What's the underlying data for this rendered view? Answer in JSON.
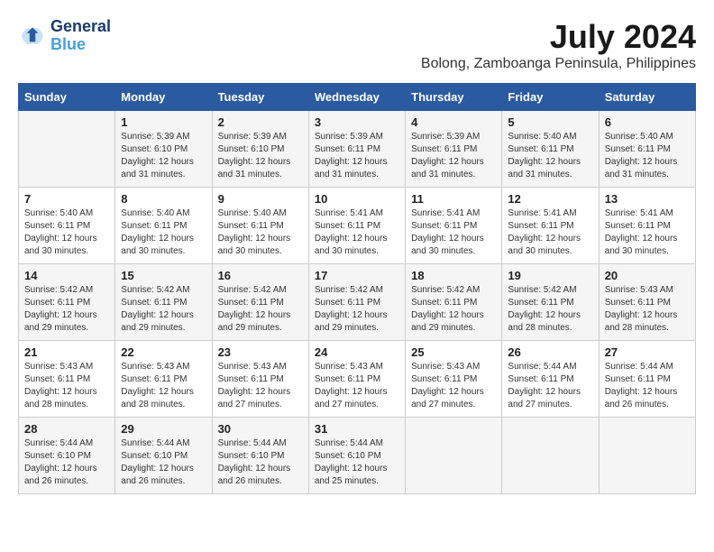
{
  "logo": {
    "line1": "General",
    "line2": "Blue"
  },
  "title": "July 2024",
  "location": "Bolong, Zamboanga Peninsula, Philippines",
  "weekdays": [
    "Sunday",
    "Monday",
    "Tuesday",
    "Wednesday",
    "Thursday",
    "Friday",
    "Saturday"
  ],
  "weeks": [
    [
      {
        "day": "",
        "sunrise": "",
        "sunset": "",
        "daylight": ""
      },
      {
        "day": "1",
        "sunrise": "Sunrise: 5:39 AM",
        "sunset": "Sunset: 6:10 PM",
        "daylight": "Daylight: 12 hours and 31 minutes."
      },
      {
        "day": "2",
        "sunrise": "Sunrise: 5:39 AM",
        "sunset": "Sunset: 6:10 PM",
        "daylight": "Daylight: 12 hours and 31 minutes."
      },
      {
        "day": "3",
        "sunrise": "Sunrise: 5:39 AM",
        "sunset": "Sunset: 6:11 PM",
        "daylight": "Daylight: 12 hours and 31 minutes."
      },
      {
        "day": "4",
        "sunrise": "Sunrise: 5:39 AM",
        "sunset": "Sunset: 6:11 PM",
        "daylight": "Daylight: 12 hours and 31 minutes."
      },
      {
        "day": "5",
        "sunrise": "Sunrise: 5:40 AM",
        "sunset": "Sunset: 6:11 PM",
        "daylight": "Daylight: 12 hours and 31 minutes."
      },
      {
        "day": "6",
        "sunrise": "Sunrise: 5:40 AM",
        "sunset": "Sunset: 6:11 PM",
        "daylight": "Daylight: 12 hours and 31 minutes."
      }
    ],
    [
      {
        "day": "7",
        "sunrise": "Sunrise: 5:40 AM",
        "sunset": "Sunset: 6:11 PM",
        "daylight": "Daylight: 12 hours and 30 minutes."
      },
      {
        "day": "8",
        "sunrise": "Sunrise: 5:40 AM",
        "sunset": "Sunset: 6:11 PM",
        "daylight": "Daylight: 12 hours and 30 minutes."
      },
      {
        "day": "9",
        "sunrise": "Sunrise: 5:40 AM",
        "sunset": "Sunset: 6:11 PM",
        "daylight": "Daylight: 12 hours and 30 minutes."
      },
      {
        "day": "10",
        "sunrise": "Sunrise: 5:41 AM",
        "sunset": "Sunset: 6:11 PM",
        "daylight": "Daylight: 12 hours and 30 minutes."
      },
      {
        "day": "11",
        "sunrise": "Sunrise: 5:41 AM",
        "sunset": "Sunset: 6:11 PM",
        "daylight": "Daylight: 12 hours and 30 minutes."
      },
      {
        "day": "12",
        "sunrise": "Sunrise: 5:41 AM",
        "sunset": "Sunset: 6:11 PM",
        "daylight": "Daylight: 12 hours and 30 minutes."
      },
      {
        "day": "13",
        "sunrise": "Sunrise: 5:41 AM",
        "sunset": "Sunset: 6:11 PM",
        "daylight": "Daylight: 12 hours and 30 minutes."
      }
    ],
    [
      {
        "day": "14",
        "sunrise": "Sunrise: 5:42 AM",
        "sunset": "Sunset: 6:11 PM",
        "daylight": "Daylight: 12 hours and 29 minutes."
      },
      {
        "day": "15",
        "sunrise": "Sunrise: 5:42 AM",
        "sunset": "Sunset: 6:11 PM",
        "daylight": "Daylight: 12 hours and 29 minutes."
      },
      {
        "day": "16",
        "sunrise": "Sunrise: 5:42 AM",
        "sunset": "Sunset: 6:11 PM",
        "daylight": "Daylight: 12 hours and 29 minutes."
      },
      {
        "day": "17",
        "sunrise": "Sunrise: 5:42 AM",
        "sunset": "Sunset: 6:11 PM",
        "daylight": "Daylight: 12 hours and 29 minutes."
      },
      {
        "day": "18",
        "sunrise": "Sunrise: 5:42 AM",
        "sunset": "Sunset: 6:11 PM",
        "daylight": "Daylight: 12 hours and 29 minutes."
      },
      {
        "day": "19",
        "sunrise": "Sunrise: 5:42 AM",
        "sunset": "Sunset: 6:11 PM",
        "daylight": "Daylight: 12 hours and 28 minutes."
      },
      {
        "day": "20",
        "sunrise": "Sunrise: 5:43 AM",
        "sunset": "Sunset: 6:11 PM",
        "daylight": "Daylight: 12 hours and 28 minutes."
      }
    ],
    [
      {
        "day": "21",
        "sunrise": "Sunrise: 5:43 AM",
        "sunset": "Sunset: 6:11 PM",
        "daylight": "Daylight: 12 hours and 28 minutes."
      },
      {
        "day": "22",
        "sunrise": "Sunrise: 5:43 AM",
        "sunset": "Sunset: 6:11 PM",
        "daylight": "Daylight: 12 hours and 28 minutes."
      },
      {
        "day": "23",
        "sunrise": "Sunrise: 5:43 AM",
        "sunset": "Sunset: 6:11 PM",
        "daylight": "Daylight: 12 hours and 27 minutes."
      },
      {
        "day": "24",
        "sunrise": "Sunrise: 5:43 AM",
        "sunset": "Sunset: 6:11 PM",
        "daylight": "Daylight: 12 hours and 27 minutes."
      },
      {
        "day": "25",
        "sunrise": "Sunrise: 5:43 AM",
        "sunset": "Sunset: 6:11 PM",
        "daylight": "Daylight: 12 hours and 27 minutes."
      },
      {
        "day": "26",
        "sunrise": "Sunrise: 5:44 AM",
        "sunset": "Sunset: 6:11 PM",
        "daylight": "Daylight: 12 hours and 27 minutes."
      },
      {
        "day": "27",
        "sunrise": "Sunrise: 5:44 AM",
        "sunset": "Sunset: 6:11 PM",
        "daylight": "Daylight: 12 hours and 26 minutes."
      }
    ],
    [
      {
        "day": "28",
        "sunrise": "Sunrise: 5:44 AM",
        "sunset": "Sunset: 6:10 PM",
        "daylight": "Daylight: 12 hours and 26 minutes."
      },
      {
        "day": "29",
        "sunrise": "Sunrise: 5:44 AM",
        "sunset": "Sunset: 6:10 PM",
        "daylight": "Daylight: 12 hours and 26 minutes."
      },
      {
        "day": "30",
        "sunrise": "Sunrise: 5:44 AM",
        "sunset": "Sunset: 6:10 PM",
        "daylight": "Daylight: 12 hours and 26 minutes."
      },
      {
        "day": "31",
        "sunrise": "Sunrise: 5:44 AM",
        "sunset": "Sunset: 6:10 PM",
        "daylight": "Daylight: 12 hours and 25 minutes."
      },
      {
        "day": "",
        "sunrise": "",
        "sunset": "",
        "daylight": ""
      },
      {
        "day": "",
        "sunrise": "",
        "sunset": "",
        "daylight": ""
      },
      {
        "day": "",
        "sunrise": "",
        "sunset": "",
        "daylight": ""
      }
    ]
  ]
}
